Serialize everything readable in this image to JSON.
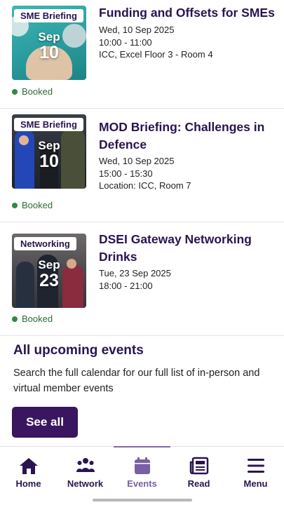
{
  "events": [
    {
      "badge": "SME Briefing",
      "month": "Sep",
      "day": "10",
      "title": "Funding and Offsets for SMEs",
      "date": "Wed, 10 Sep 2025",
      "time": "10:00  -  11:00",
      "location": "ICC, Excel Floor 3 - Room 4",
      "status": "Booked"
    },
    {
      "badge": "SME Briefing",
      "month": "Sep",
      "day": "10",
      "title": "MOD Briefing: Challenges in Defence",
      "date": "Wed, 10 Sep 2025",
      "time": "15:00  -  15:30",
      "location": "Location: ICC, Room 7",
      "status": "Booked"
    },
    {
      "badge": "Networking",
      "month": "Sep",
      "day": "23",
      "title": "DSEI Gateway Networking Drinks",
      "date": "Tue, 23 Sep 2025",
      "time": "18:00  -  21:00",
      "status": "Booked"
    }
  ],
  "upcoming": {
    "title": "All upcoming events",
    "description": "Search the full calendar for our full list of in-person and virtual member events",
    "button": "See all"
  },
  "tabbar": {
    "active": "Events",
    "tabs": [
      {
        "label": "Home",
        "icon": "home-icon"
      },
      {
        "label": "Network",
        "icon": "people-icon"
      },
      {
        "label": "Events",
        "icon": "calendar-icon"
      },
      {
        "label": "Read",
        "icon": "newspaper-icon"
      },
      {
        "label": "Menu",
        "icon": "menu-icon"
      }
    ]
  },
  "colors": {
    "brand_purple": "#2a1450",
    "button_purple": "#3a1560",
    "active_tab": "#7b5fa5",
    "booked_green": "#2e8b3e"
  }
}
